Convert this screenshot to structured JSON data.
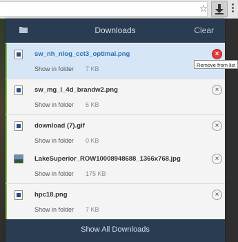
{
  "panel": {
    "title": "Downloads",
    "clear_label": "Clear",
    "footer_label": "Show All Downloads"
  },
  "downloads": [
    {
      "name": "sw_nh_nlog_cct3_optimal.png",
      "action": "Show in folder",
      "size": "7 KB",
      "icon": "file-icon"
    },
    {
      "name": "sw_mg_l_4d_brandw2.png",
      "action": "Show in folder",
      "size": "6 KB",
      "icon": "file-icon"
    },
    {
      "name": "download (7).gif",
      "action": "Show in folder",
      "size": "0 KB",
      "icon": "file-icon"
    },
    {
      "name": "LakeSuperior_ROW10008948688_1366x768.jpg",
      "action": "Show in folder",
      "size": "175 KB",
      "icon": "image-icon"
    },
    {
      "name": "hpc18.png",
      "action": "Show in folder",
      "size": "7 KB",
      "icon": "file-icon"
    }
  ],
  "tooltip": "Remove from list",
  "remove_glyph": "×",
  "colors": {
    "header": "#2a3c52",
    "highlight": "#d6e6f6",
    "remove_active": "#e03a3a",
    "progress_bar": "#7ac143"
  }
}
